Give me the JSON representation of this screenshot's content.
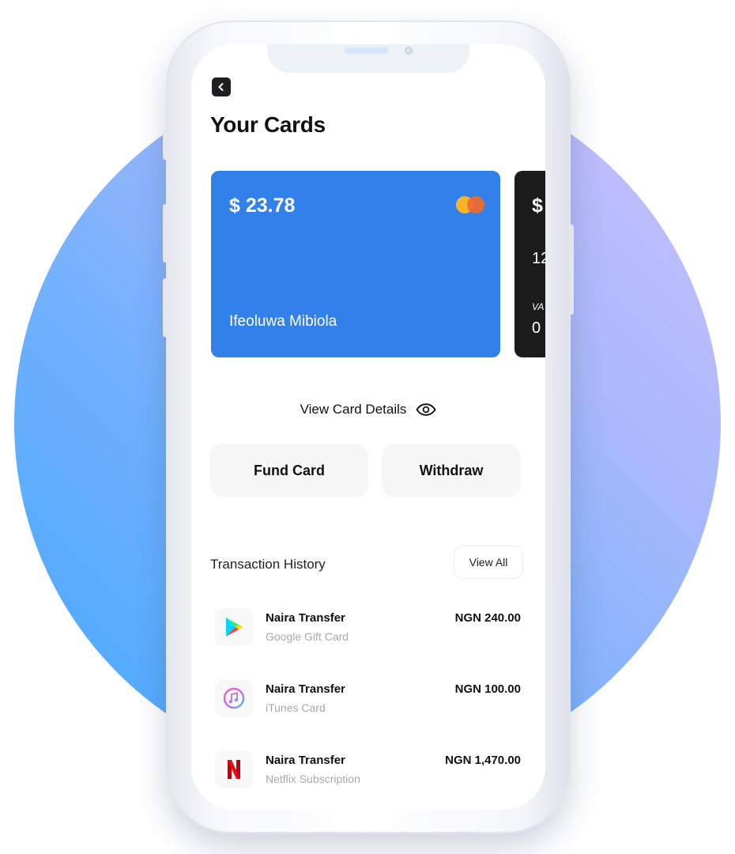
{
  "header": {
    "title": "Your Cards"
  },
  "cards": [
    {
      "amount": "$ 23.78",
      "holder": "Ifeoluwa Mibiola",
      "color": "#3280ea"
    },
    {
      "amount_partial": "$",
      "number_partial": "12",
      "valid_label_partial": "VA",
      "valid_value_partial": "0",
      "color": "#1b1b1b"
    }
  ],
  "card_actions": {
    "view_details": "View Card Details",
    "fund": "Fund Card",
    "withdraw": "Withdraw"
  },
  "transactions": {
    "title": "Transaction History",
    "view_all": "View All",
    "items": [
      {
        "name": "Naira Transfer",
        "sub": "Google Gift Card",
        "amount": "NGN 240.00",
        "icon": "google-play-icon"
      },
      {
        "name": "Naira Transfer",
        "sub": "iTunes Card",
        "amount": "NGN 100.00",
        "icon": "itunes-icon"
      },
      {
        "name": "Naira Transfer",
        "sub": "Netflix Subscription",
        "amount": "NGN 1,470.00",
        "icon": "netflix-icon"
      }
    ]
  },
  "colors": {
    "accent": "#3280ea",
    "background_gradient_start": "#45a8ff",
    "background_gradient_end": "#cfc0fb"
  }
}
